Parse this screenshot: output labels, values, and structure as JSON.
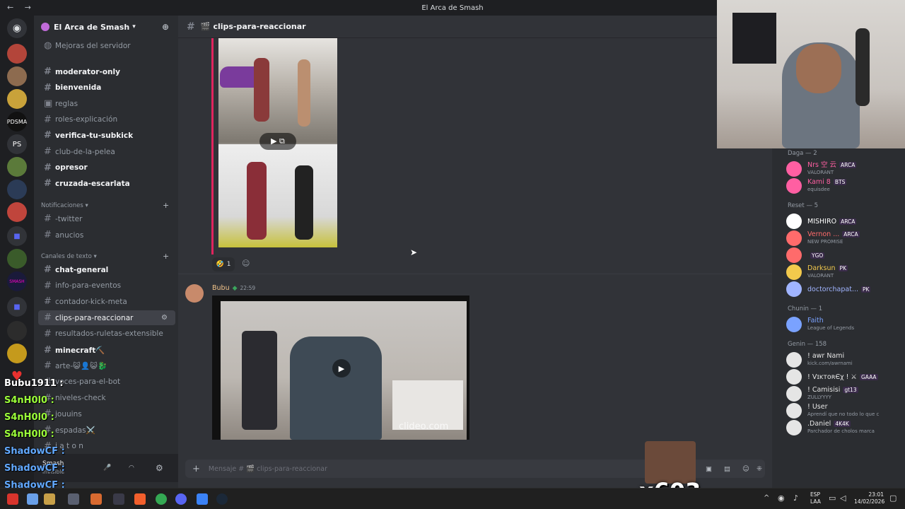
{
  "titlebar": {
    "title": "El Arca de Smash",
    "nav": "←  →"
  },
  "servers": {
    "items": [
      "",
      "",
      "",
      "PDSMA",
      "PS",
      "",
      "",
      "",
      "",
      "",
      "SMASH",
      "",
      "",
      "",
      ""
    ]
  },
  "sidebar": {
    "guild_name": "El Arca de Smash",
    "boost": "Mejoras del servidor",
    "channels": [
      {
        "label": "moderator-only",
        "style": "bold",
        "icon": "#"
      },
      {
        "label": "bienvenida",
        "style": "bold",
        "icon": "#"
      },
      {
        "label": "reglas",
        "style": "",
        "icon": "▣"
      },
      {
        "label": "roles-explicación",
        "style": "",
        "icon": "#"
      },
      {
        "label": "verifica-tu-subkick",
        "style": "bold",
        "icon": "#"
      },
      {
        "label": "club-de-la-pelea",
        "style": "",
        "icon": "#"
      },
      {
        "label": "opresor",
        "style": "bold",
        "icon": "#"
      },
      {
        "label": "cruzada-escarlata",
        "style": "bold",
        "icon": "#"
      }
    ],
    "cat_notifications": "Notificaciones",
    "notif_channels": [
      {
        "label": "-twitter",
        "style": "",
        "icon": "#"
      },
      {
        "label": "anucios",
        "style": "",
        "icon": "#"
      }
    ],
    "cat_text": "Canales de texto",
    "text_channels": [
      {
        "label": "chat-general",
        "style": "bold",
        "icon": "#"
      },
      {
        "label": "info-para-eventos",
        "style": "",
        "icon": "#"
      },
      {
        "label": "contador-kick-meta",
        "style": "",
        "icon": "#"
      },
      {
        "label": "clips-para-reaccionar",
        "style": "active",
        "icon": "#"
      },
      {
        "label": "resultados-ruletas-extensible",
        "style": "",
        "icon": "#"
      },
      {
        "label": "minecraft⛏️",
        "style": "bold",
        "icon": "#"
      },
      {
        "label": "arte-😺👤😺🐉",
        "style": "",
        "icon": "#"
      },
      {
        "label": "voces-para-el-bot",
        "style": "",
        "icon": "#"
      },
      {
        "label": "niveles-check",
        "style": "",
        "icon": "#"
      },
      {
        "label": "jouuins",
        "style": "",
        "icon": "#"
      },
      {
        "label": "espadas⚔️",
        "style": "",
        "icon": "#"
      },
      {
        "label": "j a t o n",
        "style": "",
        "icon": "#"
      }
    ],
    "user_name": "Smash",
    "user_status": "Invisible"
  },
  "chat": {
    "channel": "clips-para-reaccionar",
    "reaction_count": "1",
    "message_author": "Bubu",
    "message_time": "22:59",
    "watermark": "clideo.com",
    "composer_placeholder": "Mensaje # 🎬 clips-para-reaccionar"
  },
  "members": {
    "groups": [
      {
        "label": "Daga — 2",
        "members": [
          {
            "name": "Nrs 空 云",
            "badge": "ARCA",
            "sub": "VALORANT",
            "color": "#ff5fa2"
          },
          {
            "name": "Kami 8",
            "badge": "BTS",
            "sub": "equisdee",
            "color": "#ff5fa2"
          }
        ]
      },
      {
        "label": "Reset — 5",
        "members": [
          {
            "name": "MISHIRO",
            "badge": "ARCA",
            "sub": "",
            "color": "#ffffff"
          },
          {
            "name": "Vernon ...",
            "badge": "ARCA",
            "sub": "NEW PROMISE",
            "color": "#ff6b6b"
          },
          {
            "name": "",
            "badge": "YGO",
            "sub": "",
            "color": "#ff6b6b"
          },
          {
            "name": "Darksun",
            "badge": "PK",
            "sub": "VALORANT",
            "color": "#f2c94c"
          },
          {
            "name": "doctorchapat...",
            "badge": "PK",
            "sub": "",
            "color": "#a0b4ff"
          }
        ]
      },
      {
        "label": "Chunin — 1",
        "members": [
          {
            "name": "Faith",
            "badge": "",
            "sub": "League of Legends",
            "color": "#7aa2ff"
          }
        ]
      },
      {
        "label": "Genin — 158",
        "members": [
          {
            "name": "! awr Nami",
            "badge": "",
            "sub": "kick.com/awrnami",
            "color": "#e5e5e5"
          },
          {
            "name": "! VɪᴋᴛᴏʀЄχ ! ⚔",
            "badge": "GAAA",
            "sub": "",
            "color": "#e5e5e5"
          },
          {
            "name": "! Camisisi",
            "badge": "gt13",
            "sub": "ZULLYYYY",
            "color": "#e5e5e5"
          },
          {
            "name": "! User",
            "badge": "",
            "sub": "Aprendí que no todo lo que c",
            "color": "#e5e5e5"
          },
          {
            "name": ".Daniel",
            "badge": "4K4K",
            "sub": "Parchador de cholos marca",
            "color": "#e5e5e5"
          }
        ]
      }
    ]
  },
  "overlay": {
    "stream_chat": [
      {
        "user": "Bubu1911",
        "color": "#ffffff"
      },
      {
        "user": "S4nH0l0",
        "color": "#9cff3a"
      },
      {
        "user": "S4nH0l0",
        "color": "#9cff3a"
      },
      {
        "user": "S4nH0l0",
        "color": "#9cff3a"
      },
      {
        "user": "ShadowCF",
        "color": "#62a9ff"
      },
      {
        "user": "ShadowCF",
        "color": "#62a9ff"
      },
      {
        "user": "ShadowCF",
        "color": "#62a9ff"
      }
    ],
    "combo": "x603"
  },
  "taskbar": {
    "lang": "ESP",
    "lang2": "LAA",
    "time": "23:01",
    "date": "14/02/2026"
  }
}
